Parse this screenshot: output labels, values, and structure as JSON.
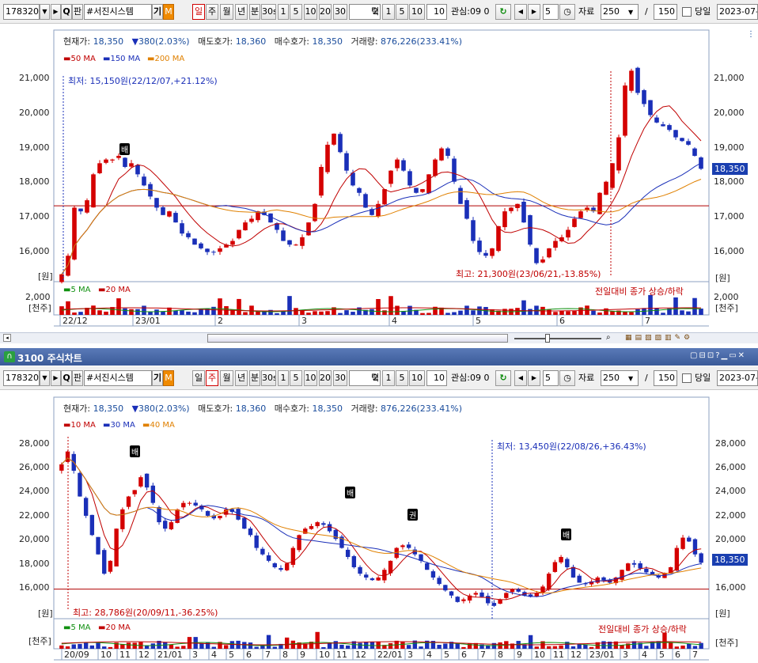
{
  "toolbar1": {
    "code": "178320",
    "search_icon_label": "Q",
    "fan_label": "판",
    "name": "#서진시스템",
    "gi_label": "기",
    "m_label": "M",
    "period_tabs": [
      "일",
      "주",
      "월",
      "년",
      "분",
      "30s",
      "1",
      "5",
      "10",
      "20",
      "30"
    ],
    "tick_value": "2",
    "tick_label": "틱",
    "tick_buttons": [
      "1",
      "5",
      "10"
    ],
    "tick_custom": "10",
    "watch_label": "관심:09 0",
    "step_value": "5",
    "data_label": "자료",
    "data_count": "250",
    "slash": "/",
    "total_count": "150",
    "today_label": "당일",
    "date": "2023-07-"
  },
  "toolbar2": {
    "code": "178320",
    "search_icon_label": "Q",
    "fan_label": "판",
    "name": "#서진시스템",
    "gi_label": "기",
    "m_label": "M",
    "period_tabs": [
      "일",
      "주",
      "월",
      "년",
      "분",
      "30s",
      "1",
      "5",
      "10",
      "20",
      "30"
    ],
    "tick_value": "2",
    "tick_label": "틱",
    "tick_buttons": [
      "1",
      "5",
      "10"
    ],
    "tick_custom": "10",
    "watch_label": "관심:09 0",
    "step_value": "5",
    "data_label": "자료",
    "data_count": "250",
    "slash": "/",
    "total_count": "150",
    "today_label": "당일",
    "date": "2023-07-"
  },
  "window2_title": "3100 주식차트",
  "colors": {
    "up": "#d40000",
    "down": "#1a2fb8",
    "ma_long": "#e08000",
    "ma_mid": "#1a2fb8",
    "ma_short": "#c00000",
    "ref": "#b00000"
  },
  "chart_data": [
    {
      "type": "candlestick",
      "period": "daily",
      "info": {
        "price_label": "현재가:",
        "price": "18,350",
        "change": "380(2.03%)",
        "ask_label": "매도호가:",
        "ask": "18,360",
        "bid_label": "매수호가:",
        "bid": "18,350",
        "volume_label": "거래량:",
        "volume": "876,226(233.41%)"
      },
      "legend": [
        "50 MA",
        "150 MA",
        "200 MA"
      ],
      "y_ticks": [
        "21,000",
        "20,000",
        "19,000",
        "18,000",
        "17,000",
        "16,000"
      ],
      "ylim": [
        15300,
        21500
      ],
      "y_unit": "[원]",
      "last_price_label": "18,350",
      "low_annotation": "최저: 15,150원(22/12/07,+21.12%)",
      "high_annotation": "최고: 21,300원(23/06/21,-13.85%)",
      "badge": "배",
      "hline": 17350,
      "x_labels": [
        "22/12",
        "23/01",
        "2",
        "3",
        "4",
        "5",
        "6",
        "7"
      ],
      "closes": [
        15500,
        16000,
        17300,
        17200,
        17500,
        18200,
        18500,
        18600,
        18600,
        18700,
        18400,
        18500,
        18200,
        17900,
        17600,
        17300,
        17100,
        17200,
        16900,
        16600,
        16500,
        16300,
        16200,
        16100,
        16100,
        16200,
        16300,
        16400,
        16700,
        16900,
        17000,
        17200,
        17100,
        16900,
        16700,
        16400,
        16300,
        16300,
        16500,
        16900,
        17400,
        18400,
        19000,
        19300,
        18800,
        18300,
        17900,
        17700,
        17300,
        17100,
        17400,
        17800,
        18300,
        18600,
        18300,
        17900,
        17700,
        17800,
        18200,
        18600,
        18900,
        18700,
        18000,
        17400,
        17000,
        16400,
        16100,
        16000,
        16200,
        16800,
        17200,
        17300,
        17400,
        16900,
        16300,
        15800,
        15900,
        16200,
        16400,
        16500,
        16700,
        17000,
        17200,
        17300,
        17200,
        17700,
        18000,
        18500,
        19200,
        20600,
        21000,
        20400,
        20100,
        19800,
        19600,
        19500,
        19400,
        19200,
        19100,
        19000,
        18700,
        18350
      ],
      "volume_legend": [
        "5 MA",
        "20 MA"
      ],
      "volume_y_ticks": [
        "2,000"
      ],
      "volume_unit": "[천주]",
      "volume_note": "전일대비 종가 상승/하락"
    },
    {
      "type": "candlestick",
      "period": "weekly",
      "info": {
        "price_label": "현재가:",
        "price": "18,350",
        "change": "380(2.03%)",
        "ask_label": "매도호가:",
        "ask": "18,360",
        "bid_label": "매수호가:",
        "bid": "18,350",
        "volume_label": "거래량:",
        "volume": "876,226(233.41%)"
      },
      "legend": [
        "10 MA",
        "30 MA",
        "40 MA"
      ],
      "y_ticks": [
        "28,000",
        "26,000",
        "24,000",
        "22,000",
        "20,000",
        "18,000",
        "16,000"
      ],
      "ylim": [
        14000,
        29500
      ],
      "y_unit": "[원]",
      "last_price_label": "18,350",
      "low_annotation": "최저: 13,450원(22/08/26,+36.43%)",
      "high_annotation": "최고: 28,786원(20/09/11,-36.25%)",
      "badges": [
        "배",
        "배",
        "권",
        "배"
      ],
      "hline": 16300,
      "x_labels": [
        "20/09",
        "10",
        "11",
        "12",
        "21/01",
        "3",
        "4",
        "5",
        "6",
        "7",
        "8",
        "9",
        "10",
        "11",
        "12",
        "22/01",
        "3",
        "4",
        "5",
        "6",
        "7",
        "8",
        "9",
        "10",
        "11",
        "12",
        "23/01",
        "3",
        "4",
        "5",
        "6",
        "7"
      ],
      "closes": [
        26000,
        27000,
        25500,
        23500,
        22000,
        20500,
        19000,
        17500,
        18500,
        21000,
        22500,
        23500,
        24000,
        25000,
        24200,
        23000,
        21500,
        21000,
        21500,
        22500,
        23000,
        23000,
        22800,
        22500,
        22000,
        21800,
        22000,
        22500,
        22300,
        21700,
        21000,
        20500,
        19500,
        19000,
        18500,
        18000,
        17800,
        18300,
        19500,
        20500,
        21000,
        21200,
        21500,
        21300,
        20800,
        20200,
        19500,
        18800,
        18000,
        17500,
        17200,
        17000,
        17200,
        17800,
        18500,
        19500,
        19700,
        19500,
        19000,
        18500,
        17800,
        17200,
        16700,
        16200,
        15800,
        15300,
        15500,
        15800,
        16000,
        15700,
        15200,
        15000,
        15500,
        16000,
        16300,
        16100,
        15800,
        15700,
        16000,
        16500,
        17500,
        18400,
        18800,
        18000,
        17200,
        16800,
        16700,
        16900,
        17200,
        17000,
        16800,
        17200,
        17800,
        18300,
        18200,
        17900,
        17600,
        17400,
        17200,
        17500,
        18000,
        19500,
        20300,
        20000,
        19000,
        18350
      ],
      "volume_legend": [
        "5 MA",
        "20 MA"
      ],
      "volume_unit": "[천주]",
      "volume_note": "전일대비 종가 상승/하락"
    }
  ]
}
